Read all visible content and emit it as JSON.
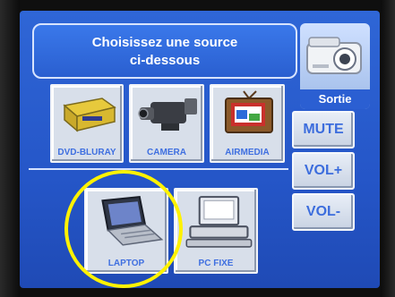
{
  "header": {
    "title_line1": "Choisissez une source",
    "title_line2": "ci-dessous"
  },
  "output": {
    "label": "Sortie",
    "icon": "projector-icon"
  },
  "sources": [
    {
      "label": "DVD-BLURAY",
      "icon": "dvd-player-icon"
    },
    {
      "label": "CAMERA",
      "icon": "camcorder-icon"
    },
    {
      "label": "AIRMEDIA",
      "icon": "tv-icon"
    },
    {
      "label": "LAPTOP",
      "icon": "laptop-icon"
    },
    {
      "label": "PC FIXE",
      "icon": "desktop-pc-icon"
    }
  ],
  "controls": {
    "mute_label": "MUTE",
    "vol_up_label": "VOL+",
    "vol_down_label": "VOL-"
  },
  "colors": {
    "screen_bg": "#2556c8",
    "button_text": "#3c6ddd",
    "highlight": "#fff200"
  }
}
